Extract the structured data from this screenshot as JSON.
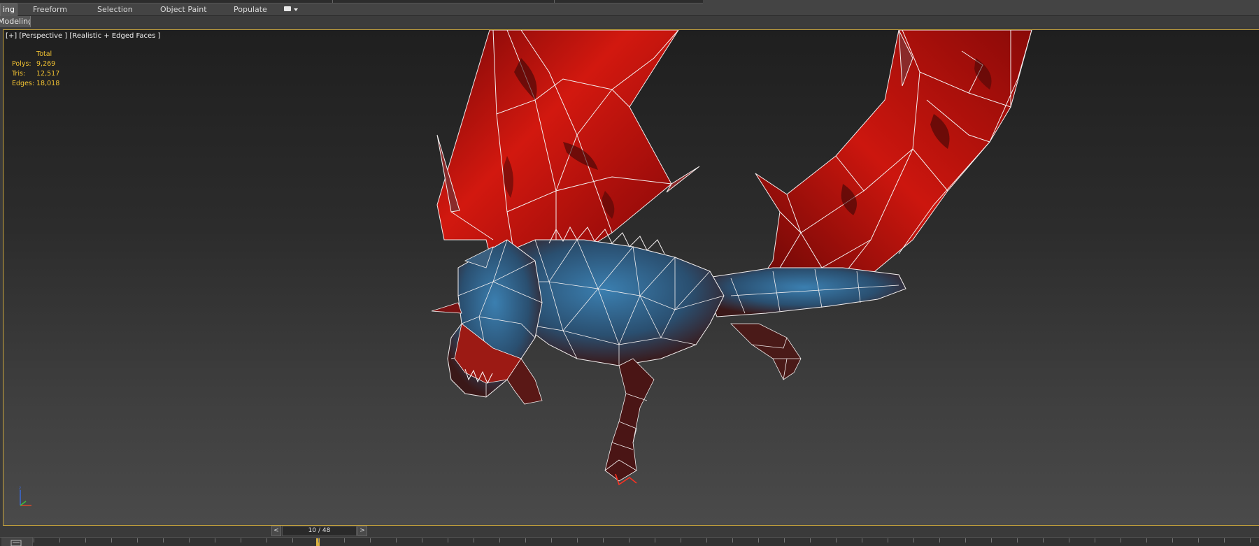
{
  "ribbon": {
    "tabs": [
      {
        "label": "ing",
        "active": true
      },
      {
        "label": "Freeform"
      },
      {
        "label": "Selection"
      },
      {
        "label": "Object Paint"
      },
      {
        "label": "Populate"
      }
    ]
  },
  "subtab": {
    "label": "Modeling"
  },
  "viewport": {
    "label": "[+] [Perspective ] [Realistic + Edged Faces ]",
    "stats": {
      "header": "Total",
      "rows": [
        {
          "label": "Polys:",
          "value": "9,269"
        },
        {
          "label": "Tris:",
          "value": "12,517"
        },
        {
          "label": "Edges:",
          "value": "18,018"
        }
      ]
    },
    "gizmo_axis_z": "z"
  },
  "timeslider": {
    "prev": "<",
    "next": ">",
    "counter": "10 / 48",
    "current_frame": 10,
    "total_frames": 48
  },
  "colors": {
    "viewport_border": "#c8a43c",
    "stats_text": "#f2c232",
    "wing_red": "#c0140f",
    "body_blue": "#2a6a9c"
  },
  "icons": [
    "ribbon-toggle-icon",
    "axis-gizmo-icon",
    "timeline-icon"
  ]
}
